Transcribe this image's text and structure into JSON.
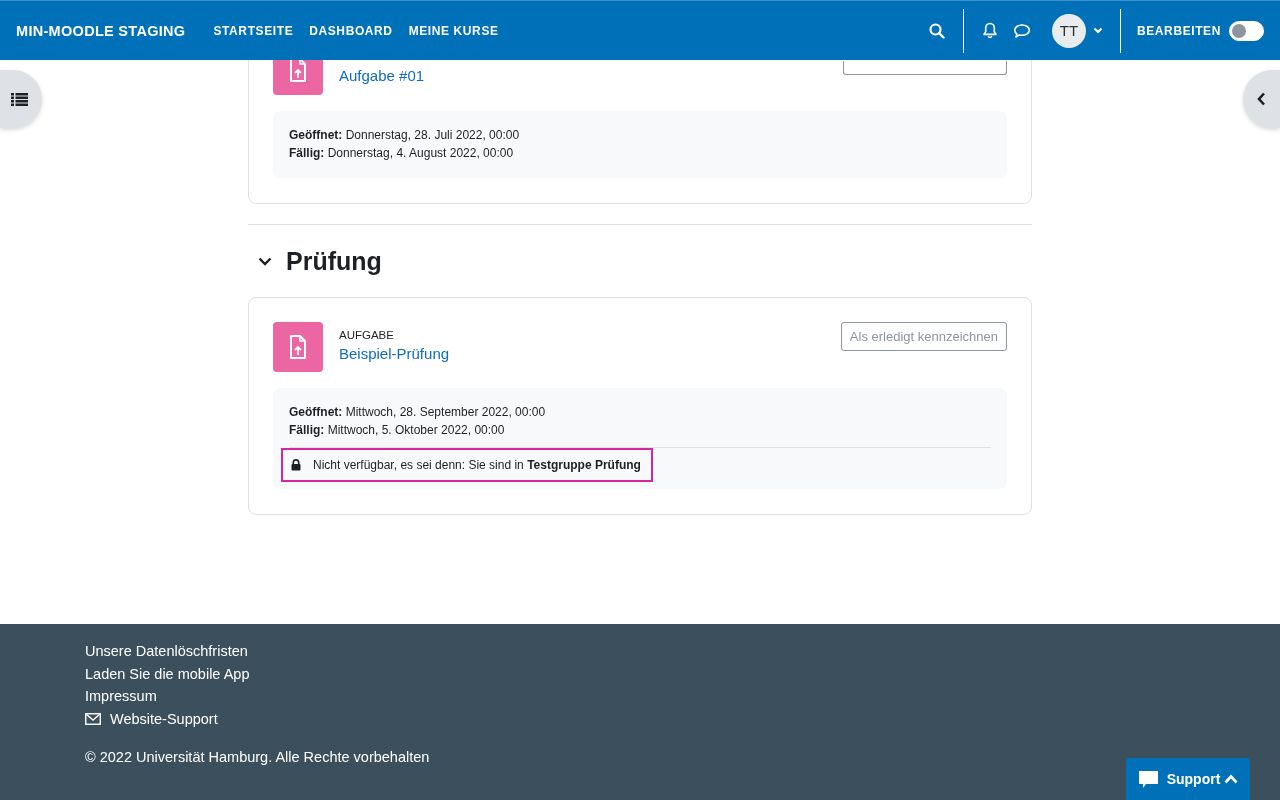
{
  "navbar": {
    "site_name": "MIN-MOODLE STAGING",
    "links": [
      "STARTSEITE",
      "DASHBOARD",
      "MEINE KURSE"
    ],
    "avatar": "TT",
    "edit_mode": {
      "label": "BEARBEITEN",
      "on": false
    }
  },
  "sections": [
    {
      "activities": [
        {
          "title": "Aufgabe #01",
          "button_cut": true,
          "dates": [
            {
              "label": "Geöffnet:",
              "value": "Donnerstag, 28. Juli 2022, 00:00"
            },
            {
              "label": "Fällig:",
              "value": "Donnerstag, 4. August 2022, 00:00"
            }
          ]
        }
      ]
    },
    {
      "title": "Prüfung",
      "expanded": true,
      "activities": [
        {
          "type_label": "AUFGABE",
          "title": "Beispiel-Prüfung",
          "button": "Als erledigt kennzeichnen",
          "dates": [
            {
              "label": "Geöffnet:",
              "value": "Mittwoch, 28. September 2022, 00:00"
            },
            {
              "label": "Fällig:",
              "value": "Mittwoch, 5. Oktober 2022, 00:00"
            }
          ],
          "restriction": {
            "text": "Nicht verfügbar, es sei denn: Sie sind in **Testgruppe Prüfung**",
            "highlighted": true
          }
        }
      ]
    }
  ],
  "footer": {
    "links": [
      {
        "text": "Unsere Datenlöschfristen",
        "kind": "link"
      },
      {
        "text": "Laden Sie die mobile App",
        "kind": "link"
      },
      {
        "text": "Impressum",
        "kind": "link"
      },
      {
        "text": "Website-Support",
        "kind": "mail"
      }
    ],
    "copyright": "© 2022 Universität Hamburg. Alle Rechte vorbehalten"
  },
  "support_button": "Support"
}
